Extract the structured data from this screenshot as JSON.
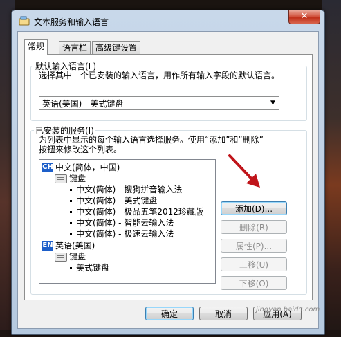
{
  "window": {
    "title": "文本服务和输入语言",
    "close_glyph": "✕"
  },
  "tabs": [
    {
      "label": "常规",
      "active": true
    },
    {
      "label": "语言栏",
      "active": false
    },
    {
      "label": "高级键设置",
      "active": false
    }
  ],
  "default_lang": {
    "legend": "默认输入语言(L)",
    "description": "选择其中一个已安装的输入语言，用作所有输入字段的默认语言。",
    "selected": "英语(美国) - 美式键盘"
  },
  "installed": {
    "legend": "已安装的服务(I)",
    "description_line1": "为列表中显示的每个输入语言选择服务。使用“添加”和“删除”",
    "description_line2": "按钮来修改这个列表。"
  },
  "tree": {
    "lang1": {
      "badge": "CH",
      "label": "中文(简体，中国)"
    },
    "lang1_keyboard": "键盘",
    "lang1_services": [
      "中文(简体) - 搜狗拼音输入法",
      "中文(简体) - 美式键盘",
      "中文(简体) - 极品五笔2012珍藏版",
      "中文(简体) - 智能云输入法",
      "中文(简体) - 极速云输入法"
    ],
    "lang2": {
      "badge": "EN",
      "label": "英语(美国)"
    },
    "lang2_keyboard": "键盘",
    "lang2_services": [
      "美式键盘"
    ]
  },
  "side_buttons": {
    "add": "添加(D)...",
    "remove": "删除(R)",
    "properties": "属性(P)...",
    "move_up": "上移(U)",
    "move_down": "下移(O)"
  },
  "bottom_buttons": {
    "ok": "确定",
    "cancel": "取消",
    "apply": "应用(A)"
  },
  "watermark": "jingyan.baidu.com",
  "colors": {
    "badge": "#1d5fc9",
    "annotation_arrow": "#c0141a"
  }
}
